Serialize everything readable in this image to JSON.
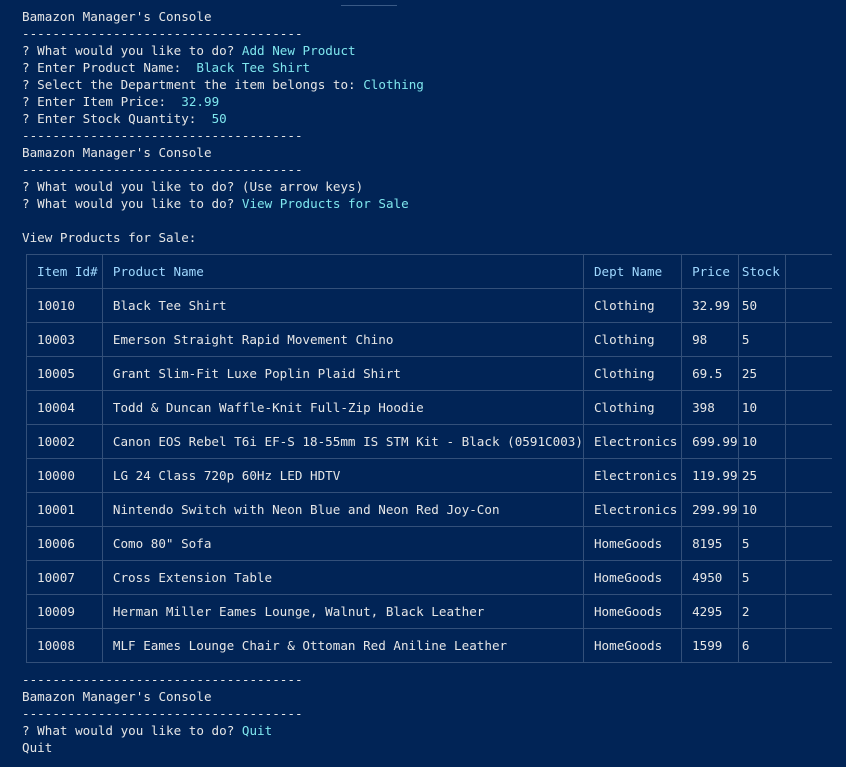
{
  "app_title": "Bamazon Manager's Console",
  "separator": "-------------------------------------",
  "session1": {
    "lines": [
      {
        "prompt": "? What would you like to do? ",
        "answer": "Add New Product"
      },
      {
        "prompt": "? Enter Product Name:  ",
        "answer": "Black Tee Shirt"
      },
      {
        "prompt": "? Select the Department the item belongs to: ",
        "answer": "Clothing"
      },
      {
        "prompt": "? Enter Item Price:  ",
        "answer": "32.99"
      },
      {
        "prompt": "? Enter Stock Quantity:  ",
        "answer": "50"
      }
    ]
  },
  "session2": {
    "line1": "? What would you like to do? (Use arrow keys)",
    "line2_prompt": "? What would you like to do? ",
    "line2_answer": "View Products for Sale",
    "heading": "View Products for Sale:"
  },
  "table": {
    "headers": [
      "Item Id#",
      "Product Name",
      "Dept Name",
      "Price",
      "Stock"
    ],
    "rows": [
      [
        "10010",
        "Black Tee Shirt",
        "Clothing",
        "32.99",
        "50"
      ],
      [
        "10003",
        "Emerson Straight Rapid Movement Chino",
        "Clothing",
        "98",
        "5"
      ],
      [
        "10005",
        "Grant Slim-Fit Luxe Poplin Plaid Shirt",
        "Clothing",
        "69.5",
        "25"
      ],
      [
        "10004",
        "Todd & Duncan Waffle-Knit Full-Zip Hoodie",
        "Clothing",
        "398",
        "10"
      ],
      [
        "10002",
        "Canon EOS Rebel T6i EF-S 18-55mm IS STM Kit - Black (0591C003)",
        "Electronics",
        "699.99",
        "10"
      ],
      [
        "10000",
        "LG 24 Class 720p 60Hz LED HDTV",
        "Electronics",
        "119.99",
        "25"
      ],
      [
        "10001",
        "Nintendo Switch with Neon Blue and Neon Red Joy-Con",
        "Electronics",
        "299.99",
        "10"
      ],
      [
        "10006",
        "Como 80\" Sofa",
        "HomeGoods",
        "8195",
        "5"
      ],
      [
        "10007",
        "Cross Extension Table",
        "HomeGoods",
        "4950",
        "5"
      ],
      [
        "10009",
        "Herman Miller Eames Lounge, Walnut, Black Leather",
        "HomeGoods",
        "4295",
        "2"
      ],
      [
        "10008",
        "MLF Eames Lounge Chair & Ottoman Red Aniline Leather",
        "HomeGoods",
        "1599",
        "6"
      ]
    ]
  },
  "session3": {
    "prompt": "? What would you like to do? ",
    "answer": "Quit",
    "final": "Quit"
  },
  "colors": {
    "background": "#012456",
    "answer": "#7fe7ee",
    "header": "#9fd8ff",
    "text": "#e6e6e6"
  }
}
